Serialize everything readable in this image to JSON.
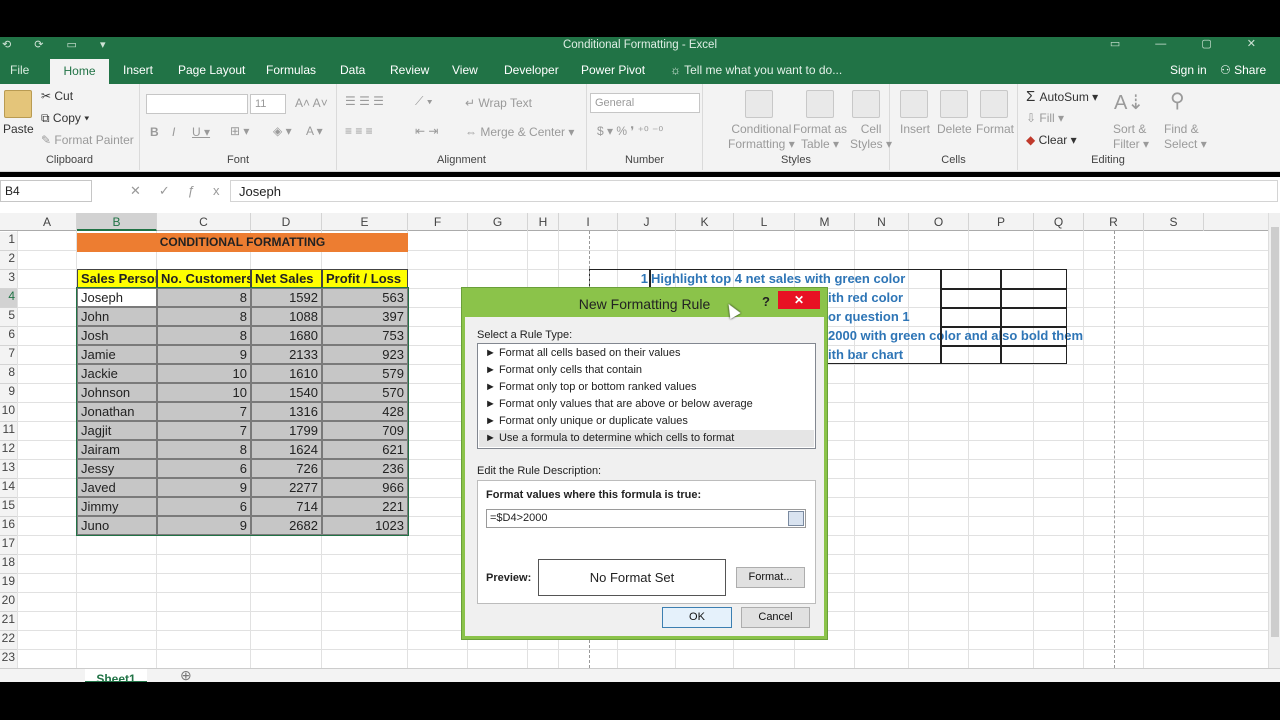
{
  "window": {
    "title": "Conditional Formatting - Excel"
  },
  "tabs": {
    "file": "File",
    "items": [
      "Home",
      "Insert",
      "Page Layout",
      "Formulas",
      "Data",
      "Review",
      "View",
      "Developer",
      "Power Pivot"
    ],
    "tell_me": "Tell me what you want to do...",
    "sign_in": "Sign in",
    "share": "Share"
  },
  "ribbon": {
    "clipboard": {
      "paste": "Paste",
      "cut": "Cut",
      "copy": "Copy",
      "format_painter": "Format Painter",
      "label": "Clipboard"
    },
    "font": {
      "size": "11",
      "label": "Font"
    },
    "alignment": {
      "wrap": "Wrap Text",
      "merge": "Merge & Center",
      "label": "Alignment"
    },
    "number": {
      "format": "General",
      "label": "Number"
    },
    "styles": {
      "cond1": "Conditional",
      "cond2": "Formatting",
      "fmt1": "Format as",
      "fmt2": "Table",
      "cell1": "Cell",
      "cell2": "Styles",
      "label": "Styles"
    },
    "cells": {
      "insert": "Insert",
      "delete": "Delete",
      "format": "Format",
      "label": "Cells"
    },
    "editing": {
      "autosum": "AutoSum",
      "fill": "Fill",
      "clear": "Clear",
      "sort1": "Sort &",
      "sort2": "Filter",
      "find1": "Find &",
      "find2": "Select",
      "label": "Editing"
    }
  },
  "formula_bar": {
    "name_box": "B4",
    "value": "Joseph"
  },
  "sheet": {
    "columns": [
      "A",
      "B",
      "C",
      "D",
      "E",
      "F",
      "G",
      "H",
      "I",
      "J",
      "K",
      "L",
      "M",
      "N",
      "O",
      "P",
      "Q",
      "R",
      "S"
    ],
    "rows": [
      "1",
      "2",
      "3",
      "4",
      "5",
      "6",
      "7",
      "8",
      "9",
      "10",
      "11",
      "12",
      "13",
      "14",
      "15",
      "16",
      "17",
      "18",
      "19",
      "20",
      "21",
      "22",
      "23"
    ],
    "banner": "CONDITIONAL FORMATTING",
    "table_headers": [
      "Sales Person",
      "No. Customers",
      "Net Sales",
      "Profit / Loss"
    ],
    "table_rows": [
      [
        "Joseph",
        "8",
        "1592",
        "563"
      ],
      [
        "John",
        "8",
        "1088",
        "397"
      ],
      [
        "Josh",
        "8",
        "1680",
        "753"
      ],
      [
        "Jamie",
        "9",
        "2133",
        "923"
      ],
      [
        "Jackie",
        "10",
        "1610",
        "579"
      ],
      [
        "Johnson",
        "10",
        "1540",
        "570"
      ],
      [
        "Jonathan",
        "7",
        "1316",
        "428"
      ],
      [
        "Jagjit",
        "7",
        "1799",
        "709"
      ],
      [
        "Jairam",
        "8",
        "1624",
        "621"
      ],
      [
        "Jessy",
        "6",
        "726",
        "236"
      ],
      [
        "Javed",
        "9",
        "2277",
        "966"
      ],
      [
        "Jimmy",
        "6",
        "714",
        "221"
      ],
      [
        "Juno",
        "9",
        "2682",
        "1023"
      ]
    ],
    "question_number": "1",
    "questions": [
      "Highlight top 4 net sales with green color",
      "ith red color",
      "or question 1",
      "2000 with green color and also bold them",
      "ith bar chart"
    ],
    "sheet_tab": "Sheet1"
  },
  "dialog": {
    "title": "New Formatting Rule",
    "help": "?",
    "close": "✕",
    "select_label": "Select a Rule Type:",
    "rule_types": [
      "Format all cells based on their values",
      "Format only cells that contain",
      "Format only top or bottom ranked values",
      "Format only values that are above or below average",
      "Format only unique or duplicate values",
      "Use a formula to determine which cells to format"
    ],
    "edit_label": "Edit the Rule Description:",
    "formula_label": "Format values where this formula is true:",
    "formula": "=$D4>2000",
    "preview_label": "Preview:",
    "preview_text": "No Format Set",
    "format_button": "Format...",
    "ok": "OK",
    "cancel": "Cancel"
  }
}
